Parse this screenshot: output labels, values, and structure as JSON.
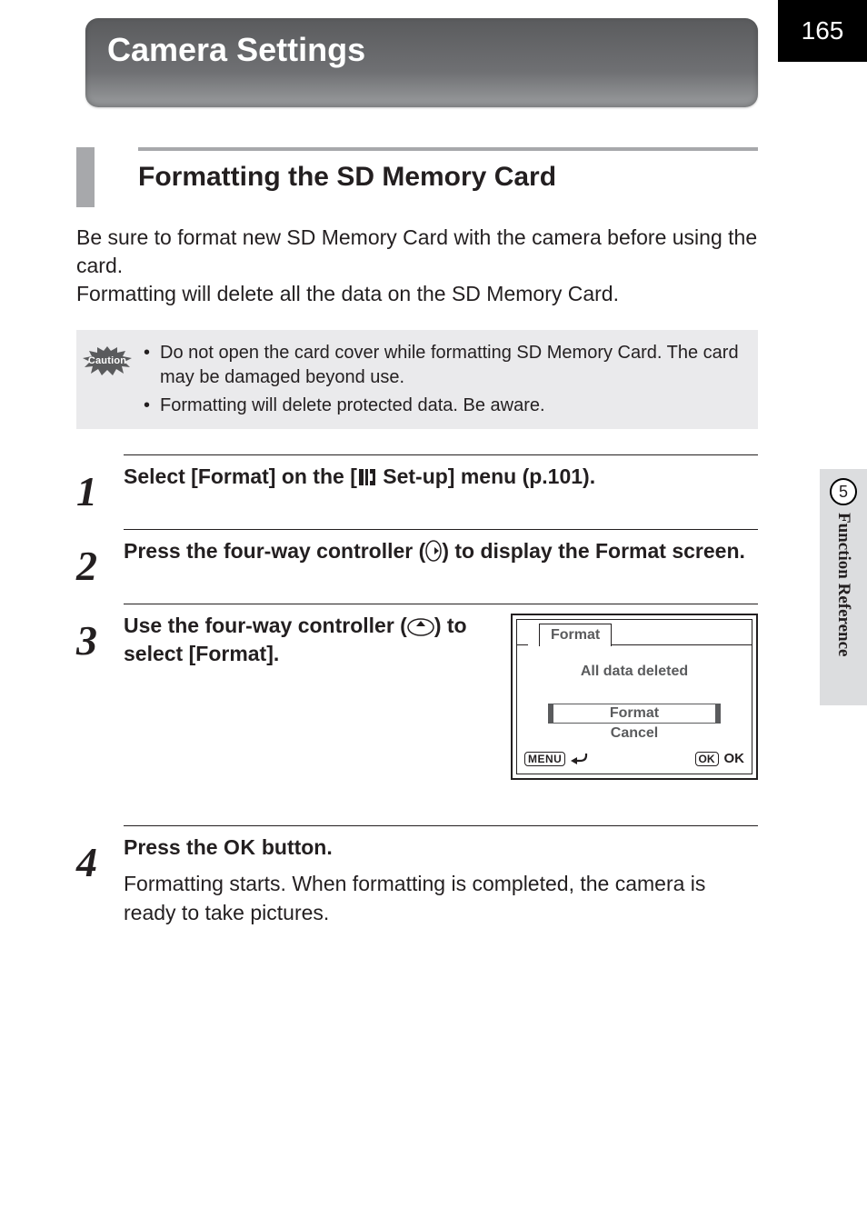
{
  "page_number": "165",
  "sidebar": {
    "chapter_number": "5",
    "label": "Function Reference"
  },
  "title": "Camera Settings",
  "section_heading": "Formatting the SD Memory Card",
  "intro_line1": "Be sure to format new SD Memory Card with the camera before using the card.",
  "intro_line2": "Formatting will delete all the data on the SD Memory Card.",
  "caution": {
    "badge": "Caution",
    "items": [
      "Do not open the card cover while formatting SD Memory Card. The card may be damaged beyond use.",
      "Formatting will delete protected data. Be aware."
    ]
  },
  "steps": {
    "s1": {
      "num": "1",
      "head_before": "Select [Format] on the [",
      "head_after": " Set-up] menu (p.101)."
    },
    "s2": {
      "num": "2",
      "head_before": "Press the four-way controller (",
      "head_after": ") to display the Format screen."
    },
    "s3": {
      "num": "3",
      "head_before": "Use the four-way controller (",
      "head_after": ") to select [Format].",
      "lcd": {
        "tab": "Format",
        "message": "All data deleted",
        "option_format": "Format",
        "option_cancel": "Cancel",
        "menu_label": "MENU",
        "ok_badge": "OK",
        "ok_label": "OK"
      }
    },
    "s4": {
      "num": "4",
      "head_before": "Press the ",
      "ok": "OK",
      "head_after": " button.",
      "desc": "Formatting starts. When formatting is completed, the camera is ready to take pictures."
    }
  }
}
